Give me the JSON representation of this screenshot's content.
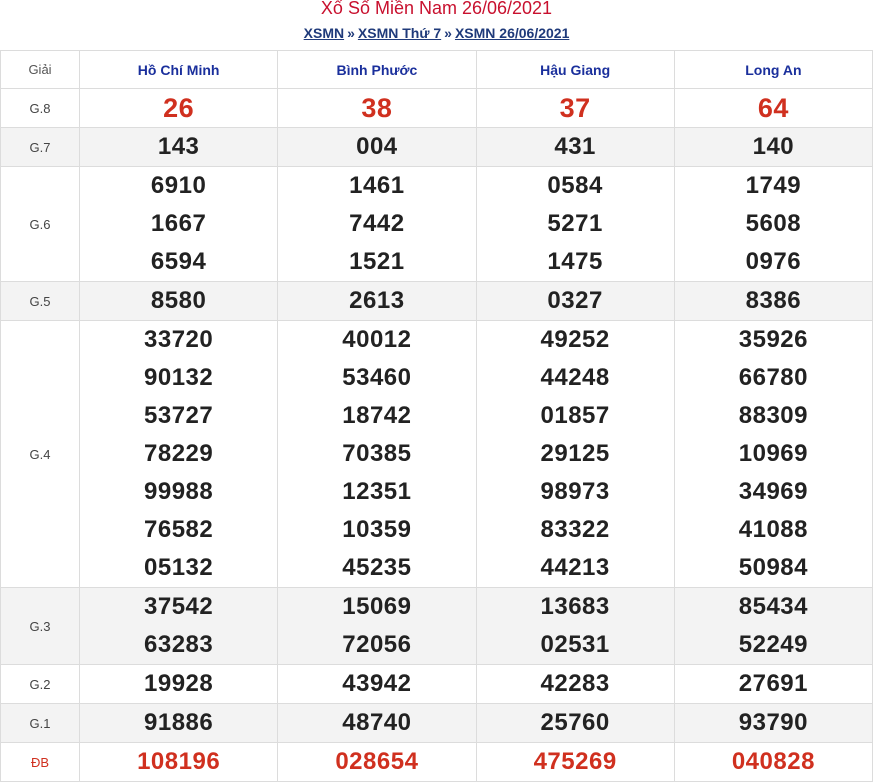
{
  "page": {
    "title": "Xổ Số Miền Nam 26/06/2021",
    "breadcrumb": [
      "XSMN",
      "XSMN Thứ 7",
      "XSMN 26/06/2021"
    ],
    "separator": "»"
  },
  "table": {
    "header_label": "Giải",
    "provinces": [
      "Hồ Chí Minh",
      "Bình Phước",
      "Hậu Giang",
      "Long An"
    ],
    "prizes": [
      {
        "label": "G.8",
        "values": [
          [
            "26"
          ],
          [
            "38"
          ],
          [
            "37"
          ],
          [
            "64"
          ]
        ]
      },
      {
        "label": "G.7",
        "values": [
          [
            "143"
          ],
          [
            "004"
          ],
          [
            "431"
          ],
          [
            "140"
          ]
        ]
      },
      {
        "label": "G.6",
        "values": [
          [
            "6910",
            "1667",
            "6594"
          ],
          [
            "1461",
            "7442",
            "1521"
          ],
          [
            "0584",
            "5271",
            "1475"
          ],
          [
            "1749",
            "5608",
            "0976"
          ]
        ]
      },
      {
        "label": "G.5",
        "values": [
          [
            "8580"
          ],
          [
            "2613"
          ],
          [
            "0327"
          ],
          [
            "8386"
          ]
        ]
      },
      {
        "label": "G.4",
        "values": [
          [
            "33720",
            "90132",
            "53727",
            "78229",
            "99988",
            "76582",
            "05132"
          ],
          [
            "40012",
            "53460",
            "18742",
            "70385",
            "12351",
            "10359",
            "45235"
          ],
          [
            "49252",
            "44248",
            "01857",
            "29125",
            "98973",
            "83322",
            "44213"
          ],
          [
            "35926",
            "66780",
            "88309",
            "10969",
            "34969",
            "41088",
            "50984"
          ]
        ]
      },
      {
        "label": "G.3",
        "values": [
          [
            "37542",
            "63283"
          ],
          [
            "15069",
            "72056"
          ],
          [
            "13683",
            "02531"
          ],
          [
            "85434",
            "52249"
          ]
        ]
      },
      {
        "label": "G.2",
        "values": [
          [
            "19928"
          ],
          [
            "43942"
          ],
          [
            "42283"
          ],
          [
            "27691"
          ]
        ]
      },
      {
        "label": "G.1",
        "values": [
          [
            "91886"
          ],
          [
            "48740"
          ],
          [
            "25760"
          ],
          [
            "93790"
          ]
        ]
      },
      {
        "label": "ĐB",
        "values": [
          [
            "108196"
          ],
          [
            "028654"
          ],
          [
            "475269"
          ],
          [
            "040828"
          ]
        ]
      }
    ]
  },
  "colors": {
    "title": "#c8102e",
    "province": "#1a2f9c",
    "highlight": "#d0301f"
  }
}
